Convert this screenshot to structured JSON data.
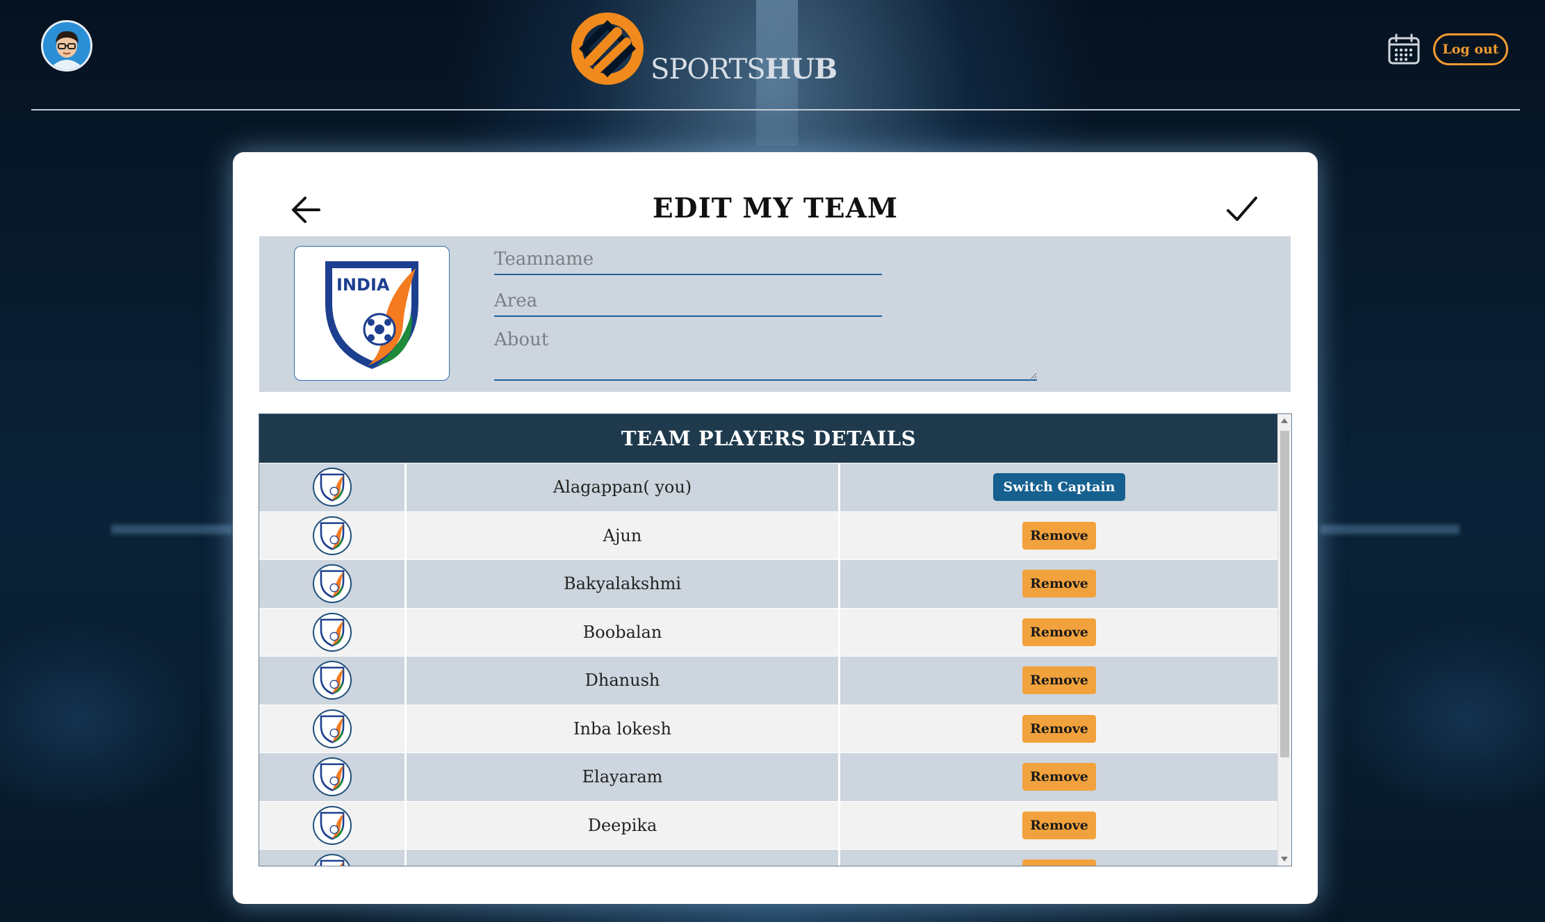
{
  "header": {
    "brand_light": "SPORTS",
    "brand_bold": "HUB",
    "logout_label": "Log out",
    "icons": {
      "avatar": "user-avatar",
      "calendar": "calendar-icon",
      "logo": "sportshub-logo"
    }
  },
  "editor": {
    "title": "EDIT MY TEAM",
    "team_logo_text": "INDIA",
    "fields": {
      "teamname_placeholder": "Teamname",
      "area_placeholder": "Area",
      "about_placeholder": "About"
    }
  },
  "players_table": {
    "heading": "TEAM PLAYERS DETAILS",
    "rows": [
      {
        "name": "Alagappan( you)",
        "action": "Switch Captain"
      },
      {
        "name": "Ajun",
        "action": "Remove"
      },
      {
        "name": "Bakyalakshmi",
        "action": "Remove"
      },
      {
        "name": "Boobalan",
        "action": "Remove"
      },
      {
        "name": "Dhanush",
        "action": "Remove"
      },
      {
        "name": "Inba lokesh",
        "action": "Remove"
      },
      {
        "name": "Elayaram",
        "action": "Remove"
      },
      {
        "name": "Deepika",
        "action": "Remove"
      },
      {
        "name": "",
        "action": ""
      }
    ]
  },
  "colors": {
    "accent_orange": "#f39c33",
    "captain_button": "#15608f",
    "table_header": "#1f3a4d",
    "row_alt": "#cdd5de"
  }
}
